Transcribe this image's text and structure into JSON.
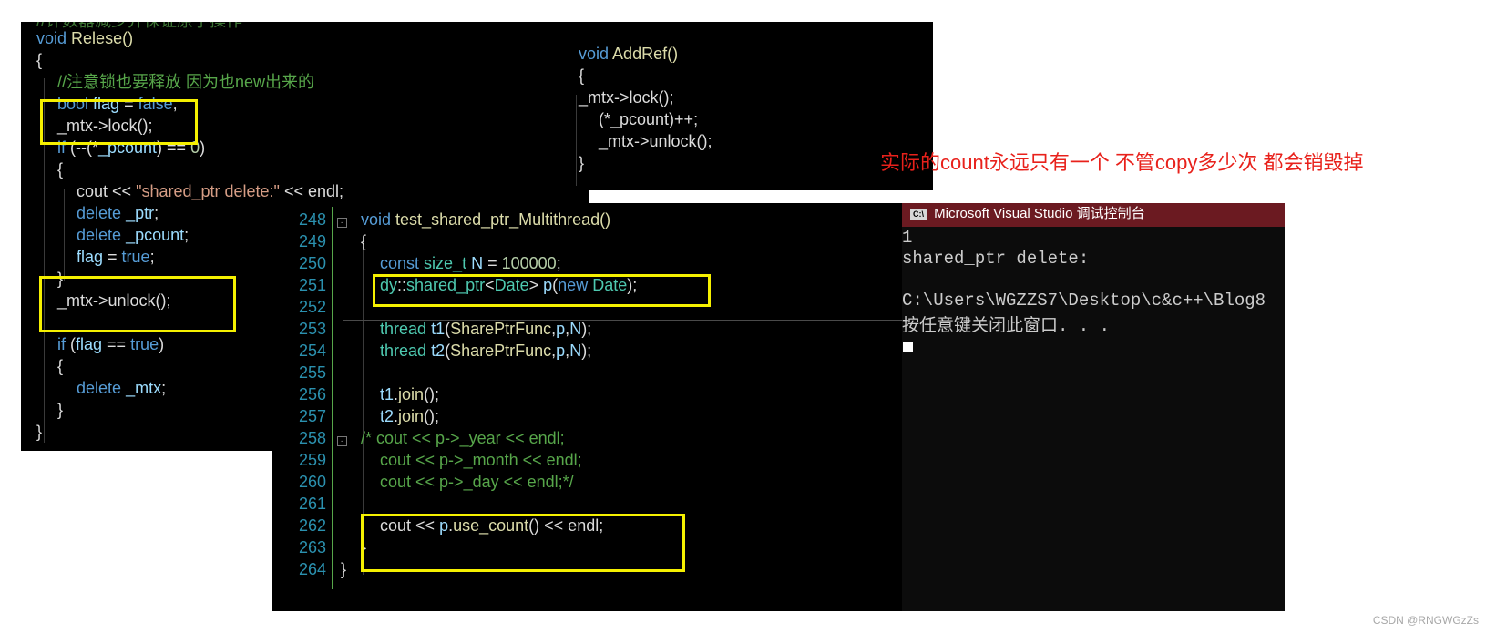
{
  "left_code": {
    "lines": [
      "//计数器减少并保证原子操作",
      "void Relese()",
      "{",
      "//注意锁也要释放 因为也new出来的",
      "bool flag = false;",
      "_mtx->lock();",
      "if (--(*_pcount) == 0)",
      "{",
      "cout << \"shared_ptr delete:\" << endl;",
      "delete _ptr;",
      "delete _pcount;",
      "flag = true;",
      "}",
      "_mtx->unlock();",
      "",
      "if (flag == true)",
      "{",
      "delete _mtx;",
      "}",
      "}"
    ]
  },
  "addref_code": {
    "lines": [
      "void AddRef()",
      "{",
      "_mtx->lock();",
      "(*_pcount)++;",
      "_mtx->unlock();",
      "}"
    ]
  },
  "main_code": {
    "line_numbers": [
      "248",
      "249",
      "250",
      "251",
      "252",
      "253",
      "254",
      "255",
      "256",
      "257",
      "258",
      "259",
      "260",
      "261",
      "262",
      "263",
      "264"
    ],
    "lines": [
      "void test_shared_ptr_Multithread()",
      "{",
      "const size_t N = 100000;",
      "dy::shared_ptr<Date> p(new Date);",
      "",
      "thread t1(SharePtrFunc,p,N);",
      "thread t2(SharePtrFunc,p,N);",
      "",
      "t1.join();",
      "t2.join();",
      "/* cout << p->_year << endl;",
      "cout << p->_month << endl;",
      "cout << p->_day << endl;*/",
      "",
      "cout << p.use_count() << endl;",
      "}",
      "}"
    ]
  },
  "annotation": "实际的count永远只有一个 不管copy多少次 都会销毁掉",
  "console": {
    "icon_text": "C:\\",
    "title": "Microsoft Visual Studio 调试控制台",
    "output": [
      "1",
      "shared_ptr delete:",
      "",
      "C:\\Users\\WGZZS7\\Desktop\\c&c++\\Blog8",
      "按任意键关闭此窗口. . ."
    ]
  },
  "watermark": "CSDN @RNGWGzZs",
  "colors": {
    "highlight_box": "#f5f000",
    "annotation": "#e8211b",
    "console_titlebar": "#6b1a21"
  }
}
